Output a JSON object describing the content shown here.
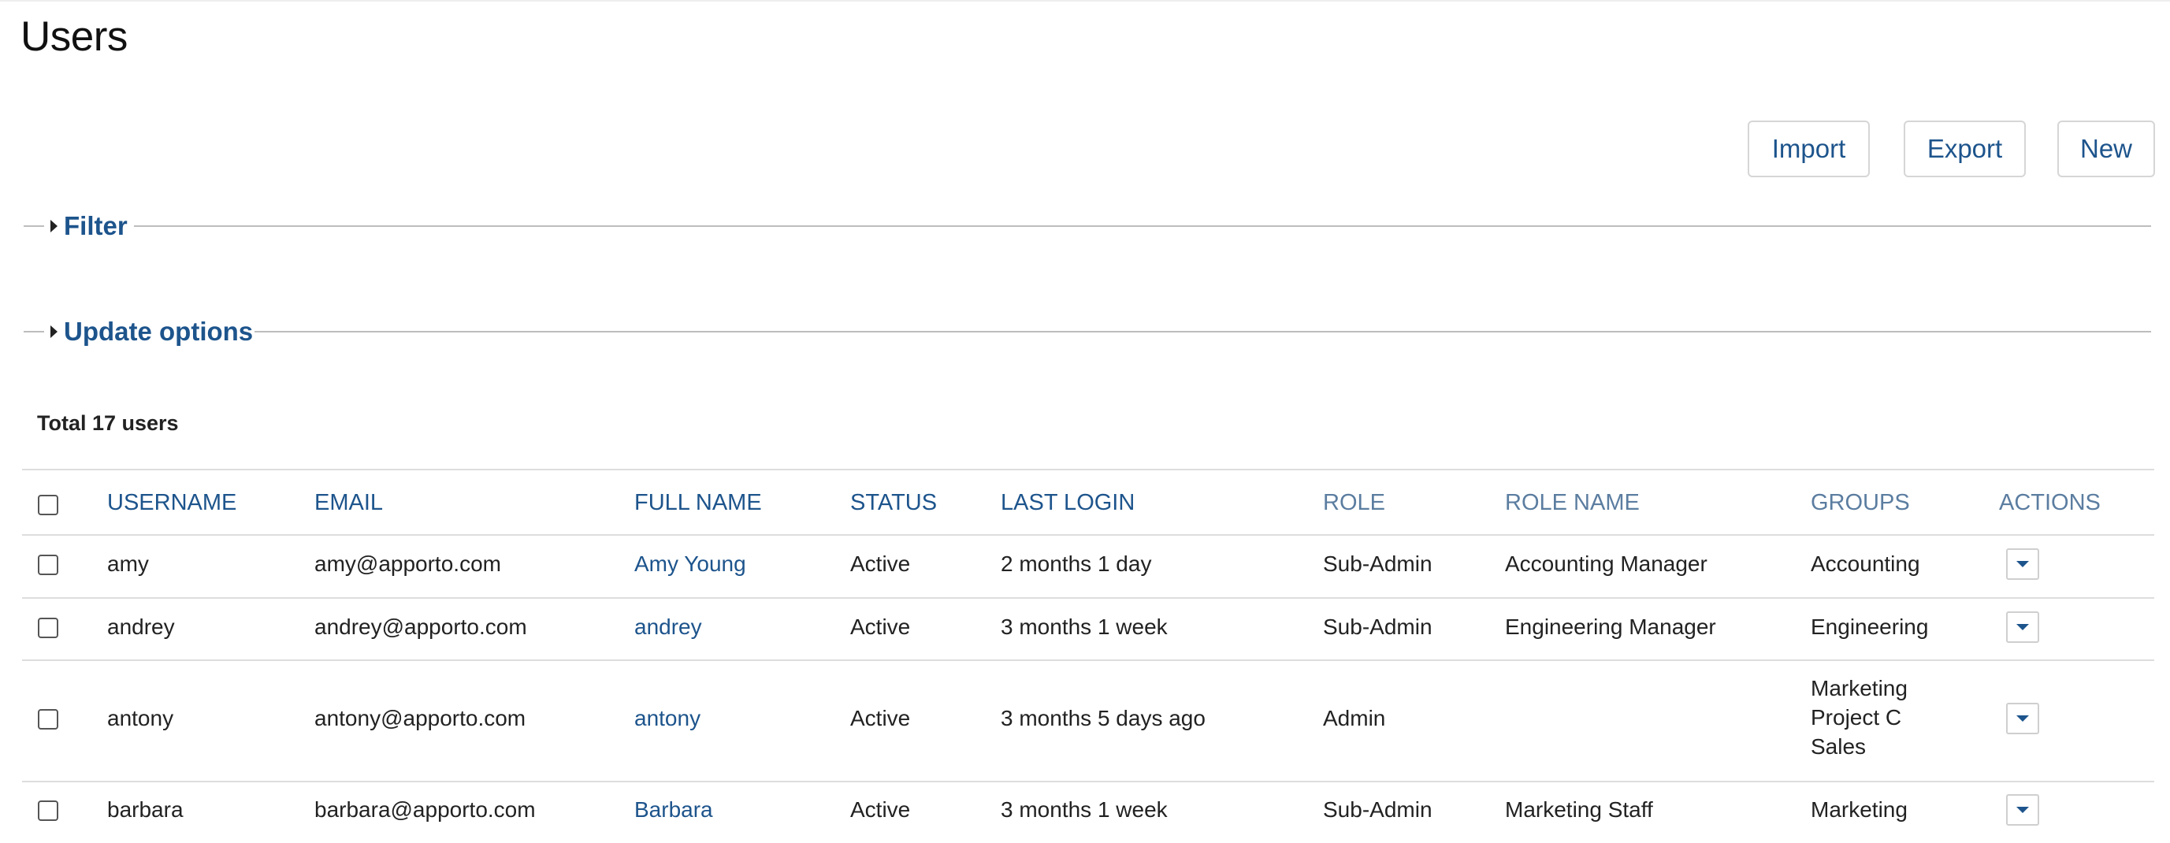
{
  "page": {
    "title": "Users"
  },
  "toolbar": {
    "import_label": "Import",
    "export_label": "Export",
    "new_label": "New"
  },
  "filter": {
    "label": "Filter"
  },
  "update_options": {
    "label": "Update options"
  },
  "summary": {
    "total_label": "Total 17 users"
  },
  "table": {
    "headers": {
      "username": "USERNAME",
      "email": "EMAIL",
      "full_name": "FULL NAME",
      "status": "STATUS",
      "last_login": "LAST LOGIN",
      "role": "ROLE",
      "role_name": "ROLE NAME",
      "groups": "GROUPS",
      "actions": "ACTIONS"
    },
    "rows": [
      {
        "username": "amy",
        "email": "amy@apporto.com",
        "full_name": "Amy Young",
        "status": "Active",
        "last_login": "2 months 1 day",
        "role": "Sub-Admin",
        "role_name": "Accounting Manager",
        "groups": [
          "Accounting"
        ]
      },
      {
        "username": "andrey",
        "email": "andrey@apporto.com",
        "full_name": "andrey",
        "status": "Active",
        "last_login": "3 months 1 week",
        "role": "Sub-Admin",
        "role_name": "Engineering Manager",
        "groups": [
          "Engineering"
        ]
      },
      {
        "username": "antony",
        "email": "antony@apporto.com",
        "full_name": "antony",
        "status": "Active",
        "last_login": "3 months 5 days ago",
        "role": "Admin",
        "role_name": "",
        "groups": [
          "Marketing",
          "Project C",
          "Sales"
        ]
      },
      {
        "username": "barbara",
        "email": "barbara@apporto.com",
        "full_name": "Barbara",
        "status": "Active",
        "last_login": "3 months 1 week",
        "role": "Sub-Admin",
        "role_name": "Marketing Staff",
        "groups": [
          "Marketing"
        ]
      }
    ]
  },
  "icons": {
    "expand": "caret-right-icon",
    "action_menu": "caret-down-icon"
  },
  "colors": {
    "accent": "#1d548c",
    "divider": "#dddddd"
  }
}
